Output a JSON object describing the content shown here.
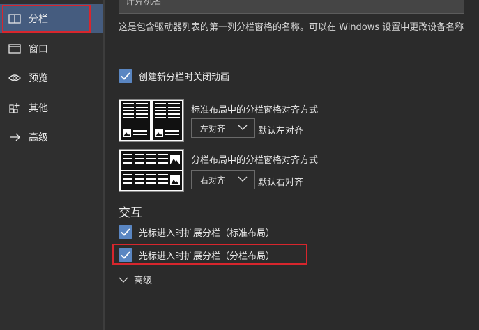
{
  "sidebar": {
    "items": [
      {
        "label": "分栏",
        "icon": "split-pane-icon"
      },
      {
        "label": "窗口",
        "icon": "window-icon"
      },
      {
        "label": "预览",
        "icon": "eye-icon"
      },
      {
        "label": "其他",
        "icon": "add-grid-icon"
      },
      {
        "label": "高级",
        "icon": "arrow-right-icon"
      }
    ],
    "active_index": 0
  },
  "main": {
    "computer_name_value": "计算机名",
    "description": "这是包含驱动器列表的第一列分栏窗格的名称。可以在 Windows 设置中更改设备名称",
    "disable_animation": {
      "label": "创建新分栏时关闭动画",
      "checked": true
    },
    "standard_layout": {
      "title": "标准布局中的分栏窗格对齐方式",
      "dropdown_value": "左对齐",
      "default_text": "默认左对齐"
    },
    "split_layout": {
      "title": "分栏布局中的分栏窗格对齐方式",
      "dropdown_value": "右对齐",
      "default_text": "默认右对齐"
    },
    "interaction_heading": "交互",
    "expand_standard": {
      "label": "光标进入时扩展分栏（标准布局）",
      "checked": true
    },
    "expand_split": {
      "label": "光标进入时扩展分栏（分栏布局）",
      "checked": true
    },
    "advanced_label": "高级"
  },
  "colors": {
    "accent": "#5a86c2",
    "active_nav": "#455c7f",
    "highlight_box": "#d7262d",
    "background": "#2b2b2b"
  }
}
